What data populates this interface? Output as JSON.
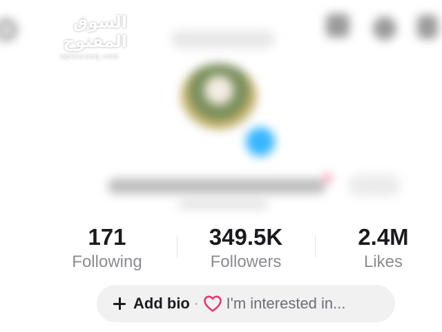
{
  "watermark": {
    "arabic": "السوق المفتوح",
    "latin": "opensooq.com"
  },
  "stats": {
    "following": {
      "value": "171",
      "label": "Following"
    },
    "followers": {
      "value": "349.5K",
      "label": "Followers"
    },
    "likes": {
      "value": "2.4M",
      "label": "Likes"
    }
  },
  "bio": {
    "add_label": "Add bio",
    "separator": "·",
    "interest_label": "I'm interested in..."
  },
  "icons": {
    "add": "plus-icon",
    "interest": "heart-icon",
    "top_bar": [
      "search-icon",
      "inbox-icon",
      "settings-icon",
      "menu-icon"
    ]
  },
  "colors": {
    "heart": "#e8356d",
    "text_primary": "#1b1b1f",
    "text_secondary": "#8a8b91",
    "pill_bg": "#f1f1f2",
    "avatar_badge": "#38b6ff"
  }
}
